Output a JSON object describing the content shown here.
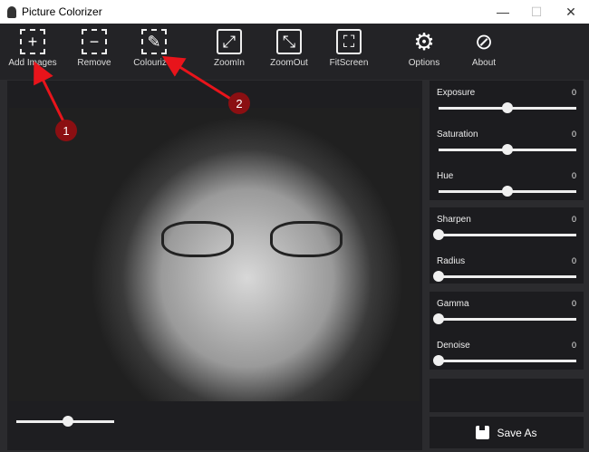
{
  "window": {
    "title": "Picture Colorizer",
    "minimize": "—",
    "maximize": "☐",
    "close": "✕"
  },
  "toolbar": [
    {
      "label": "Add Images",
      "icon": "plus-icon",
      "glyph": "+"
    },
    {
      "label": "Remove",
      "icon": "minus-icon",
      "glyph": "−"
    },
    {
      "label": "Colourizer",
      "icon": "eyedropper-icon",
      "glyph": "✎"
    },
    {
      "label": "ZoomIn",
      "icon": "zoom-in-icon",
      "glyph": "⤢"
    },
    {
      "label": "ZoomOut",
      "icon": "zoom-out-icon",
      "glyph": "⤡"
    },
    {
      "label": "FitScreen",
      "icon": "fit-screen-icon",
      "glyph": "⛶"
    },
    {
      "label": "Options",
      "icon": "gear-icon",
      "glyph": "⚙"
    },
    {
      "label": "About",
      "icon": "compass-icon",
      "glyph": "⊘"
    }
  ],
  "zoom_slider": {
    "position": 0.53
  },
  "adjustments": [
    {
      "label": "Exposure",
      "value": "0",
      "position": 0.5
    },
    {
      "label": "Saturation",
      "value": "0",
      "position": 0.5
    },
    {
      "label": "Hue",
      "value": "0",
      "position": 0.5
    },
    {
      "label": "Sharpen",
      "value": "0",
      "position": 0
    },
    {
      "label": "Radius",
      "value": "0",
      "position": 0
    },
    {
      "label": "Gamma",
      "value": "0",
      "position": 0
    },
    {
      "label": "Denoise",
      "value": "0",
      "position": 0
    }
  ],
  "save_label": "Save As",
  "annotations": [
    {
      "label": "1"
    },
    {
      "label": "2"
    }
  ],
  "colors": {
    "annotation": "#e8141b",
    "badge": "#8b0f12"
  }
}
